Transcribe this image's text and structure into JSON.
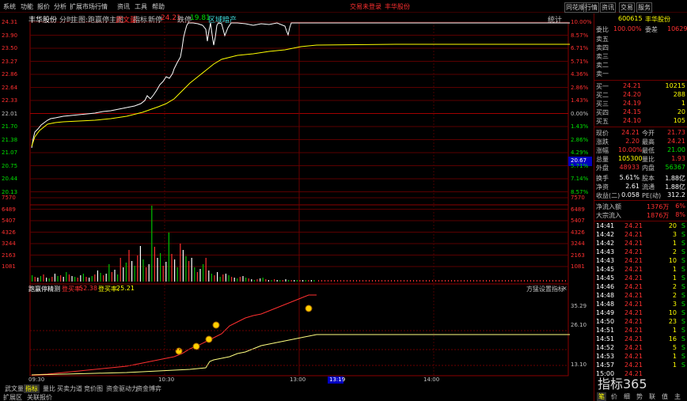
{
  "menu": {
    "items": [
      "系统",
      "功能",
      "报价",
      "分析",
      "扩展市场行情",
      "资讯",
      "工具",
      "帮助"
    ],
    "center_left": "交易未登录",
    "center_right": "丰华股份",
    "win_buttons": [
      "同花顺",
      "行情",
      "资讯",
      "交易",
      "服务"
    ]
  },
  "header": {
    "stock": "丰华股份",
    "mode": "分时",
    "main_label": "主图:跑赢停主图",
    "variant": "武文量",
    "idx_label": "指标",
    "new_label": "新停",
    "new_val": "24.21",
    "fall_label": "跌停",
    "fall_val": "19.81",
    "zone": "区域暗产",
    "stat": "统计"
  },
  "price_axis": {
    "left": [
      "24.31",
      "23.90",
      "23.50",
      "23.27",
      "22.86",
      "22.64",
      "22.33",
      "22.01",
      "21.70",
      "21.38",
      "21.07",
      "20.75",
      "20.44",
      "20.13"
    ],
    "right": [
      "10.00%",
      "8.57%",
      "6.71%",
      "5.71%",
      "4.36%",
      "2.86%",
      "1.43%",
      "0.00%",
      "1.43%",
      "2.86%",
      "4.29%",
      "5.71%",
      "7.14%",
      "8.57%"
    ],
    "cursor_price": "20.67"
  },
  "volume_axis": {
    "left": [
      "7570",
      "6489",
      "5407",
      "4326",
      "3244",
      "2163",
      "1081"
    ],
    "right": [
      "7570",
      "6489",
      "5407",
      "4326",
      "3244",
      "2163",
      "1081"
    ]
  },
  "indicator": {
    "name": "跑赢停精测",
    "l1_label": "登买率:",
    "l1_val": "52.38",
    "l2_label": "登买率:",
    "l2_val": "25.21",
    "right_btn": "方猛设置指标",
    "close": "×",
    "axis": [
      "35.29",
      "26.10",
      "13.10"
    ],
    "badges": [
      "6",
      "7",
      "8",
      "9",
      "10"
    ]
  },
  "time_axis": {
    "labels": [
      "09:30",
      "10:30",
      "13:00",
      "14:00"
    ],
    "cursor": "13:19"
  },
  "bottom_tabs": {
    "row1": [
      "武文量",
      "指标",
      "量比",
      "买卖力道",
      "竞价图",
      "资金驱动力",
      "资金博弈"
    ],
    "row2": [
      "扩展区",
      "关联报价"
    ],
    "active": 1
  },
  "panel": {
    "code": "600615",
    "name": "丰华股份",
    "wei_label": "委比",
    "wei_val": "100.00%",
    "cha_label": "委差",
    "cha_val": "10629",
    "sell": [
      {
        "label": "卖五",
        "price": "",
        "vol": ""
      },
      {
        "label": "卖四",
        "price": "",
        "vol": ""
      },
      {
        "label": "卖三",
        "price": "",
        "vol": ""
      },
      {
        "label": "卖二",
        "price": "",
        "vol": ""
      },
      {
        "label": "卖一",
        "price": "",
        "vol": ""
      }
    ],
    "buy": [
      {
        "label": "买一",
        "price": "24.21",
        "vol": "10215"
      },
      {
        "label": "买二",
        "price": "24.20",
        "vol": "288"
      },
      {
        "label": "买三",
        "price": "24.19",
        "vol": "1"
      },
      {
        "label": "买四",
        "price": "24.15",
        "vol": "20"
      },
      {
        "label": "买五",
        "price": "24.10",
        "vol": "105"
      }
    ],
    "stats": [
      {
        "l1": "现价",
        "v1": "24.21",
        "l2": "今开",
        "v2": "21.73"
      },
      {
        "l1": "涨跌",
        "v1": "2.20",
        "l2": "最高",
        "v2": "24.21"
      },
      {
        "l1": "涨幅",
        "v1": "10.00%",
        "l2": "最低",
        "v2": "21.00"
      },
      {
        "l1": "总量",
        "v1": "105300",
        "l2": "量比",
        "v2": "1.93"
      },
      {
        "l1": "外盘",
        "v1": "48933",
        "l2": "内盘",
        "v2": "56367"
      },
      {
        "l1": "换手",
        "v1": "5.61%",
        "l2": "股本",
        "v2": "1.88亿"
      },
      {
        "l1": "净资",
        "v1": "2.61",
        "l2": "流通",
        "v2": "1.88亿"
      },
      {
        "l1": "收益(二)",
        "v1": "0.058",
        "l2": "PE(动)",
        "v2": "312.2"
      }
    ],
    "flows": [
      {
        "label": "净流入额",
        "val": "1376万",
        "pct": "6%"
      },
      {
        "label": "大宗流入",
        "val": "1876万",
        "pct": "8%"
      }
    ],
    "ticks": [
      {
        "t": "14:41",
        "p": "24.21",
        "v": "20",
        "s": "S"
      },
      {
        "t": "14:42",
        "p": "24.21",
        "v": "3",
        "s": "S"
      },
      {
        "t": "14:42",
        "p": "24.21",
        "v": "1",
        "s": "S"
      },
      {
        "t": "14:43",
        "p": "24.21",
        "v": "2",
        "s": "S"
      },
      {
        "t": "14:43",
        "p": "24.21",
        "v": "10",
        "s": "S"
      },
      {
        "t": "14:45",
        "p": "24.21",
        "v": "1",
        "s": "S"
      },
      {
        "t": "14:45",
        "p": "24.21",
        "v": "1",
        "s": "S"
      },
      {
        "t": "14:46",
        "p": "24.21",
        "v": "2",
        "s": "S"
      },
      {
        "t": "14:48",
        "p": "24.21",
        "v": "2",
        "s": "S"
      },
      {
        "t": "14:48",
        "p": "24.21",
        "v": "3",
        "s": "S"
      },
      {
        "t": "14:49",
        "p": "24.21",
        "v": "10",
        "s": "S"
      },
      {
        "t": "14:50",
        "p": "24.21",
        "v": "23",
        "s": "S"
      },
      {
        "t": "14:51",
        "p": "24.21",
        "v": "1",
        "s": "S"
      },
      {
        "t": "14:51",
        "p": "24.21",
        "v": "16",
        "s": "S"
      },
      {
        "t": "14:52",
        "p": "24.21",
        "v": "5",
        "s": "S"
      },
      {
        "t": "14:53",
        "p": "24.21",
        "v": "1",
        "s": "S"
      },
      {
        "t": "14:57",
        "p": "24.21",
        "v": "1",
        "s": "S"
      },
      {
        "t": "15:00",
        "p": "24.21",
        "v": "",
        "s": ""
      }
    ],
    "side_tabs": [
      "笔",
      "价",
      "细",
      "势",
      "联",
      "值",
      "主"
    ],
    "logo": "指标365"
  }
}
